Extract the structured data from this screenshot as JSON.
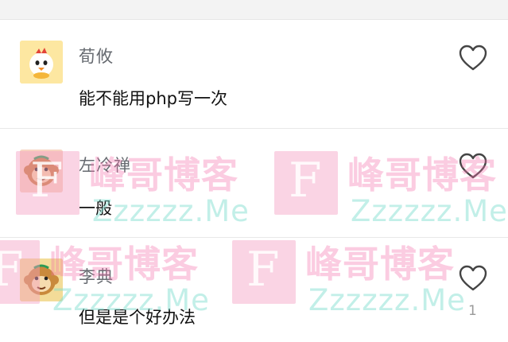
{
  "comments": [
    {
      "username": "荀攸",
      "content": "能不能用php写一次",
      "avatar_icon": "cartoon-chick-avatar-icon",
      "like_icon": "heart-outline-icon"
    },
    {
      "username": "左冷禅",
      "content": "一般",
      "avatar_icon": "cartoon-monkey-avatar-icon",
      "like_icon": "heart-outline-icon"
    },
    {
      "username": "李典",
      "content": "但是是个好办法",
      "avatar_icon": "cartoon-monkey-avatar-icon",
      "like_icon": "heart-outline-icon",
      "like_count": "1"
    }
  ],
  "watermark": {
    "letter": "F",
    "title": "峰哥博客",
    "subtitle": "Zzzzzz.Me"
  },
  "colors": {
    "username": "#666a70",
    "content": "#111111",
    "divider": "#e8e8e8",
    "watermark_pink": "#f5a0c3",
    "watermark_teal": "#78dccd"
  }
}
